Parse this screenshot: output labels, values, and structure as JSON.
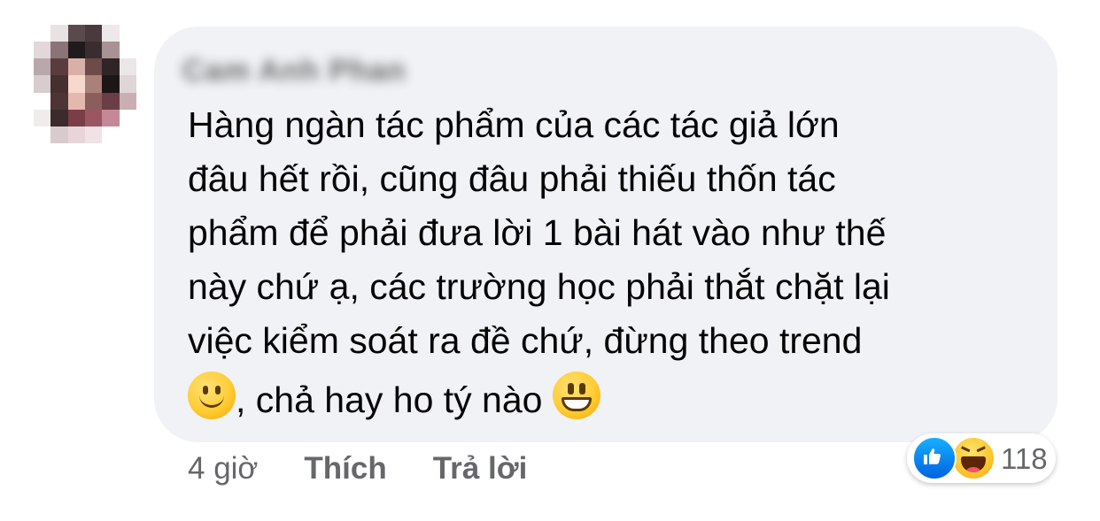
{
  "comment": {
    "author": "Cam Anh Phan",
    "text_lines": [
      "Hàng ngàn tác phẩm của các tác giả lớn",
      "đâu hết rồi, cũng đâu phải thiếu thốn tác",
      "phẩm để phải đưa lời 1 bài hát vào như thế",
      "này chứ ạ,  các trường học phải thắt chặt lại",
      "việc kiểm soát ra đề chứ,  đừng theo trend"
    ],
    "last_line_text": ", chả hay ho tý nào ",
    "emoji_start": "slightly-smiling-face-icon",
    "emoji_end": "grinning-face-icon"
  },
  "meta": {
    "time": "4 giờ",
    "like_label": "Thích",
    "reply_label": "Trả lời"
  },
  "reactions": {
    "icons": [
      "like-icon",
      "haha-icon"
    ],
    "count": "118"
  },
  "colors": {
    "bubble": "#f0f2f5",
    "secondary_text": "#65676b",
    "like_blue": "#0866ff"
  }
}
